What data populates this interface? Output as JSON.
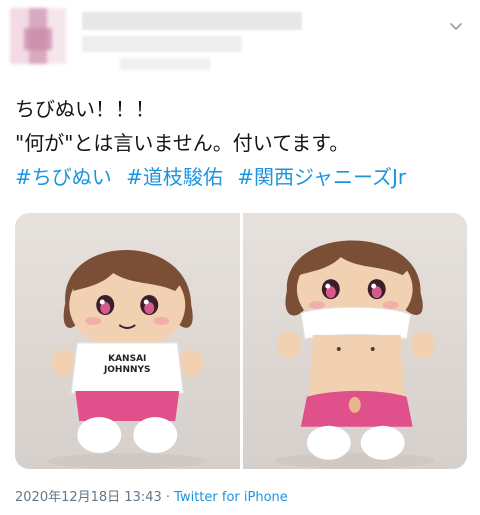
{
  "tweet": {
    "lines": [
      "ちびぬい！！！",
      "\"何が\"とは言いません。付いてます。"
    ],
    "hashtags": [
      "#ちびぬい",
      "#道枝駿佑",
      "#関西ジャニーズJr"
    ],
    "shirt_text": [
      "KANSAI",
      "JOHNNYS"
    ]
  },
  "meta": {
    "date": "2020年12月18日 13:43",
    "separator": " · ",
    "source": "Twitter for iPhone"
  },
  "colors": {
    "link": "#1b95e0",
    "meta": "#657786"
  },
  "icons": {
    "more": "chevron-down-icon"
  }
}
